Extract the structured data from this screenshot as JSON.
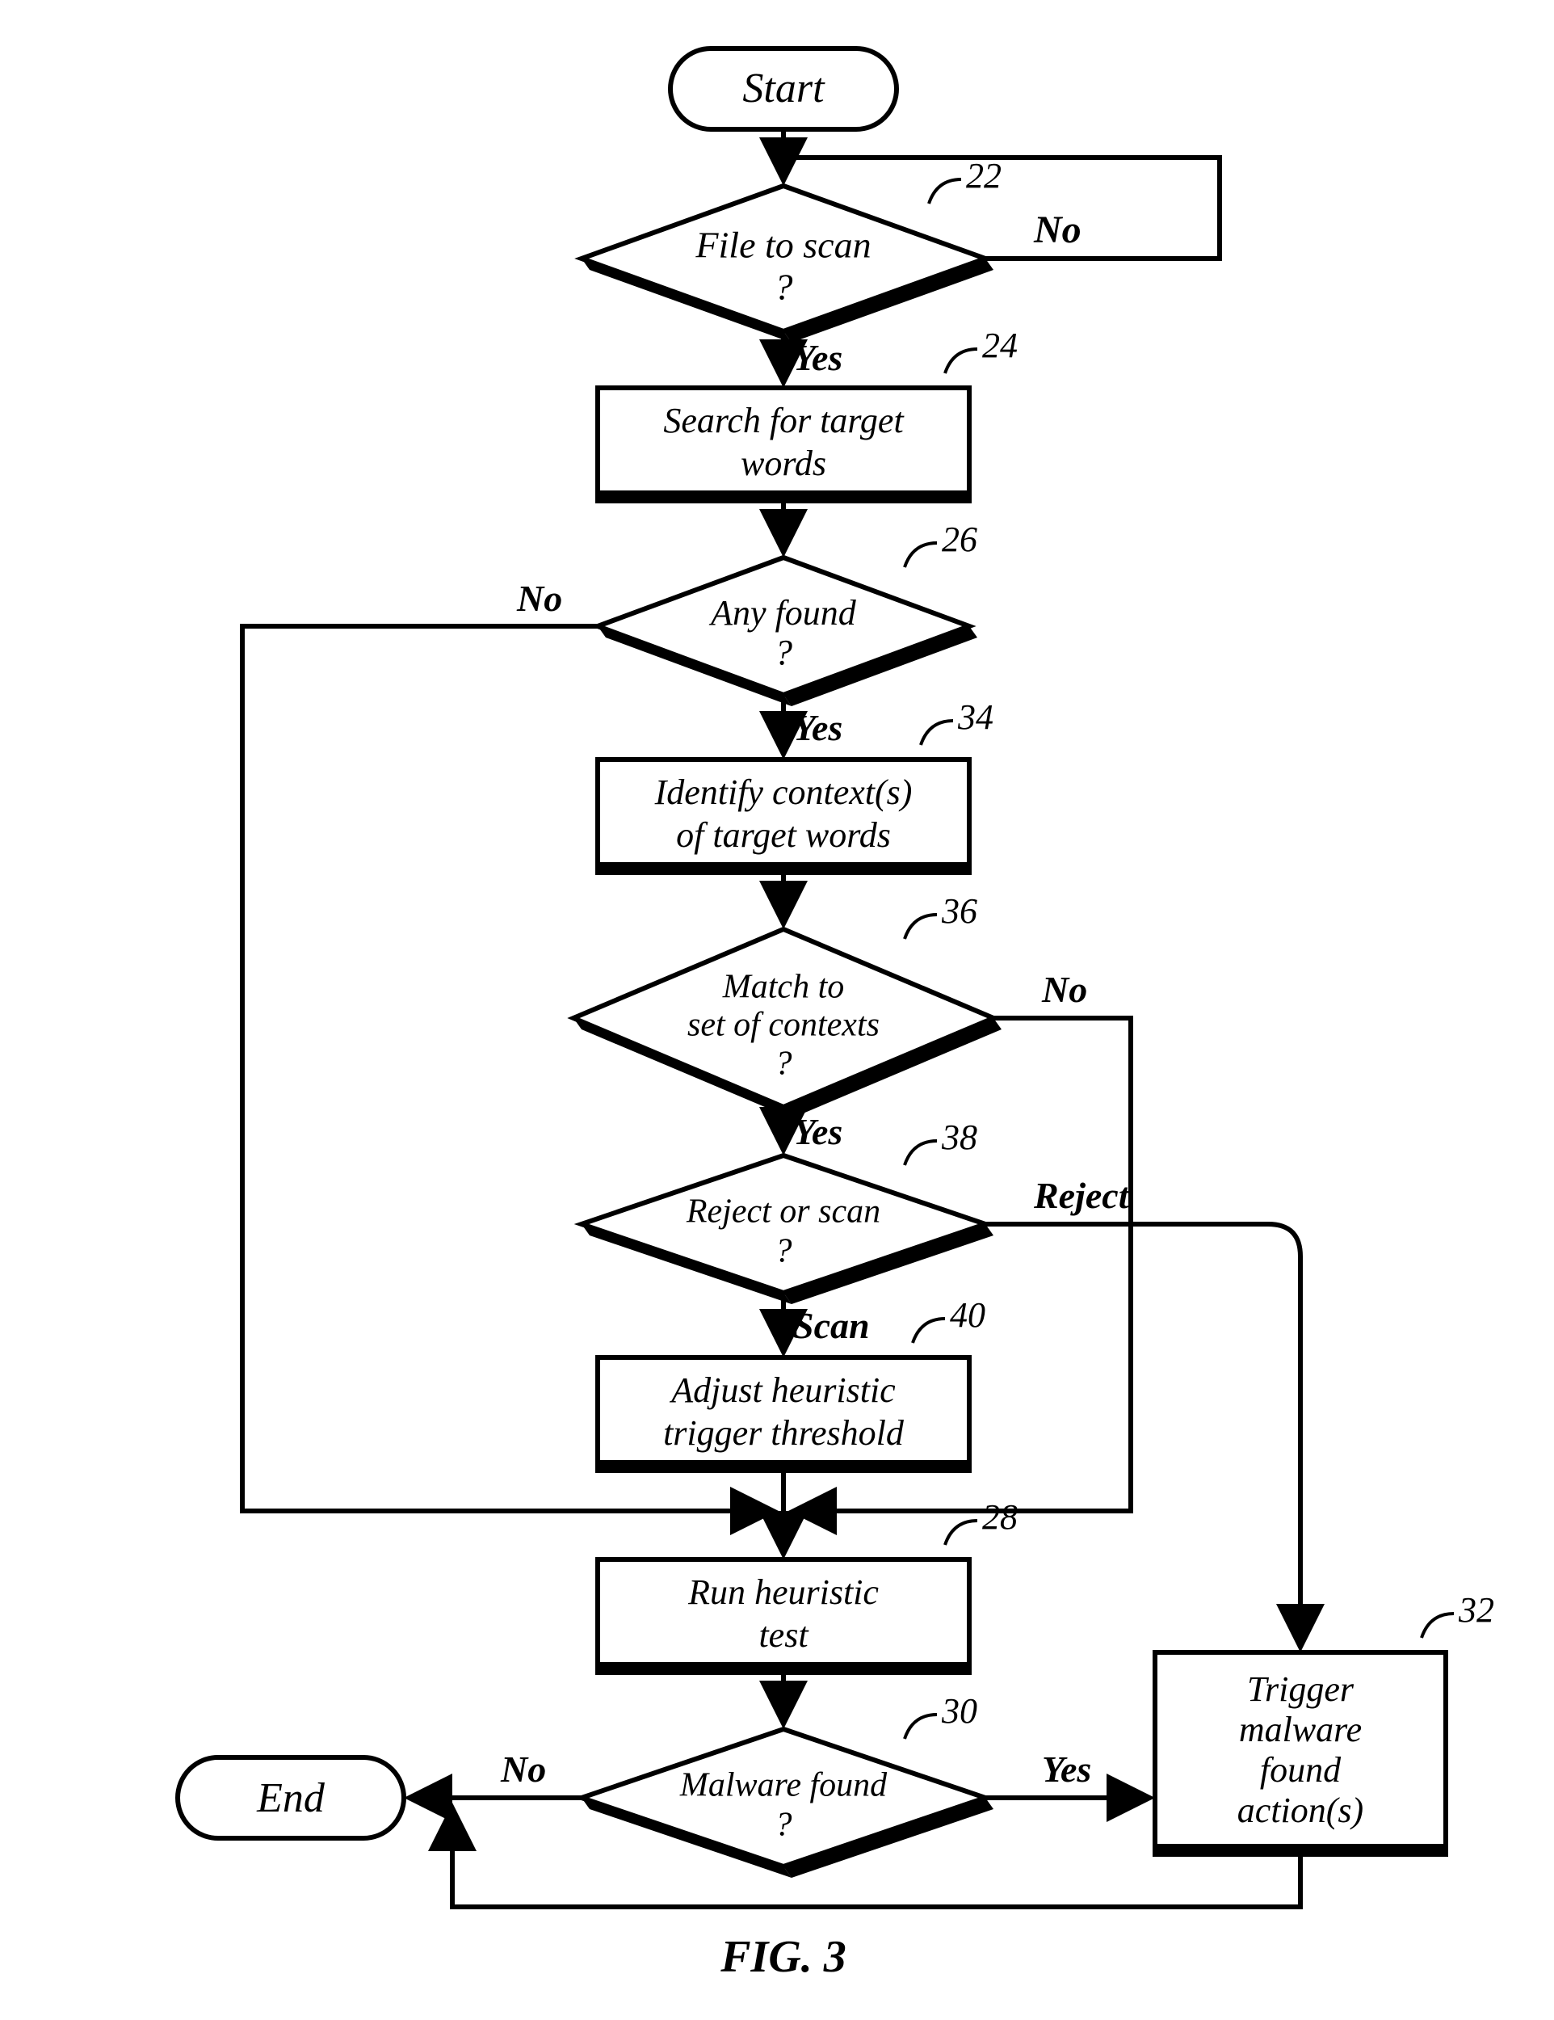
{
  "caption": "FIG. 3",
  "nodes": {
    "start": "Start",
    "end": "End",
    "d22": {
      "l1": "File to scan",
      "l2": "?"
    },
    "p24": {
      "l1": "Search for target",
      "l2": "words"
    },
    "d26": {
      "l1": "Any found",
      "l2": "?"
    },
    "p34": {
      "l1": "Identify context(s)",
      "l2": "of target words"
    },
    "d36": {
      "l1": "Match to",
      "l2": "set of contexts",
      "l3": "?"
    },
    "d38": {
      "l1": "Reject or scan",
      "l2": "?"
    },
    "p40": {
      "l1": "Adjust heuristic",
      "l2": "trigger threshold"
    },
    "p28": {
      "l1": "Run heuristic",
      "l2": "test"
    },
    "d30": {
      "l1": "Malware found",
      "l2": "?"
    },
    "p32": {
      "l1": "Trigger",
      "l2": "malware",
      "l3": "found",
      "l4": "action(s)"
    }
  },
  "labels": {
    "no": "No",
    "yes": "Yes",
    "reject": "Reject",
    "scan": "Scan"
  },
  "refs": {
    "r22": "22",
    "r24": "24",
    "r26": "26",
    "r34": "34",
    "r36": "36",
    "r38": "38",
    "r40": "40",
    "r28": "28",
    "r30": "30",
    "r32": "32"
  }
}
